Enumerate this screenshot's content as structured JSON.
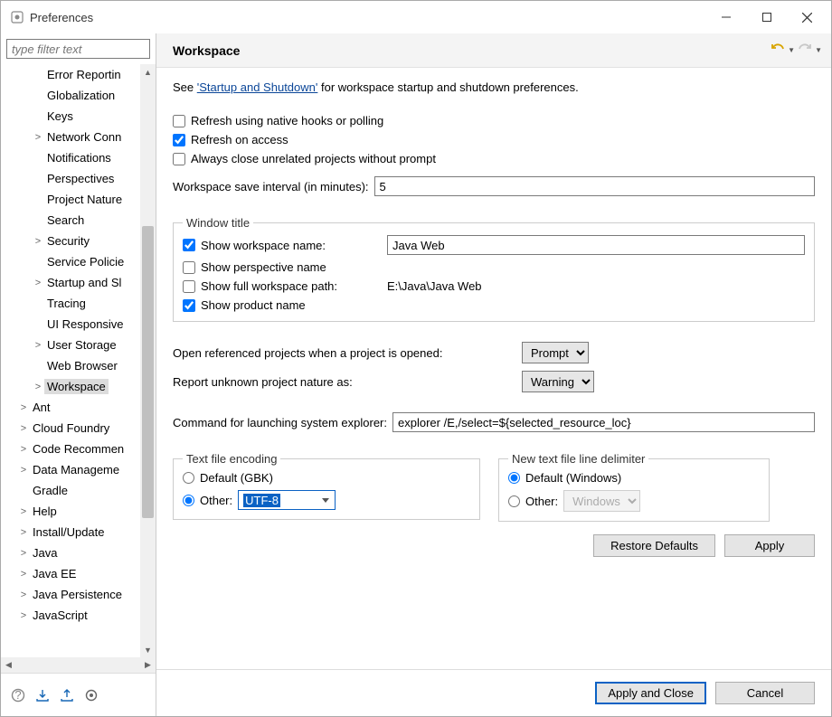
{
  "window": {
    "title": "Preferences"
  },
  "sidebar": {
    "filter_placeholder": "type filter text",
    "items": [
      {
        "label": "Error Reportin",
        "indent": 1,
        "expand": ""
      },
      {
        "label": "Globalization",
        "indent": 1,
        "expand": ""
      },
      {
        "label": "Keys",
        "indent": 1,
        "expand": ""
      },
      {
        "label": "Network Conn",
        "indent": 1,
        "expand": ">"
      },
      {
        "label": "Notifications",
        "indent": 1,
        "expand": ""
      },
      {
        "label": "Perspectives",
        "indent": 1,
        "expand": ""
      },
      {
        "label": "Project Nature",
        "indent": 1,
        "expand": ""
      },
      {
        "label": "Search",
        "indent": 1,
        "expand": ""
      },
      {
        "label": "Security",
        "indent": 1,
        "expand": ">"
      },
      {
        "label": "Service Policie",
        "indent": 1,
        "expand": ""
      },
      {
        "label": "Startup and Sl",
        "indent": 1,
        "expand": ">"
      },
      {
        "label": "Tracing",
        "indent": 1,
        "expand": ""
      },
      {
        "label": "UI Responsive",
        "indent": 1,
        "expand": ""
      },
      {
        "label": "User Storage",
        "indent": 1,
        "expand": ">"
      },
      {
        "label": "Web Browser",
        "indent": 1,
        "expand": ""
      },
      {
        "label": "Workspace",
        "indent": 1,
        "expand": ">",
        "selected": true
      },
      {
        "label": "Ant",
        "indent": 0,
        "expand": ">"
      },
      {
        "label": "Cloud Foundry",
        "indent": 0,
        "expand": ">"
      },
      {
        "label": "Code Recommen",
        "indent": 0,
        "expand": ">"
      },
      {
        "label": "Data Manageme",
        "indent": 0,
        "expand": ">"
      },
      {
        "label": "Gradle",
        "indent": 0,
        "expand": ""
      },
      {
        "label": "Help",
        "indent": 0,
        "expand": ">"
      },
      {
        "label": "Install/Update",
        "indent": 0,
        "expand": ">"
      },
      {
        "label": "Java",
        "indent": 0,
        "expand": ">"
      },
      {
        "label": "Java EE",
        "indent": 0,
        "expand": ">"
      },
      {
        "label": "Java Persistence",
        "indent": 0,
        "expand": ">"
      },
      {
        "label": "JavaScript",
        "indent": 0,
        "expand": ">"
      }
    ]
  },
  "page": {
    "title": "Workspace",
    "intro_pre": "See ",
    "intro_link": "'Startup and Shutdown'",
    "intro_post": " for workspace startup and shutdown preferences.",
    "chk_refresh_native": "Refresh using native hooks or polling",
    "chk_refresh_access": "Refresh on access",
    "chk_close_unrelated": "Always close unrelated projects without prompt",
    "save_interval_label": "Workspace save interval (in minutes):",
    "save_interval_value": "5",
    "window_title_legend": "Window title",
    "chk_show_workspace_name": "Show workspace name:",
    "workspace_name_value": "Java Web",
    "chk_show_perspective": "Show perspective name",
    "chk_show_full_path": "Show full workspace path:",
    "full_path_value": "E:\\Java\\Java Web",
    "chk_show_product": "Show product name",
    "open_ref_label": "Open referenced projects when a project is opened:",
    "open_ref_value": "Prompt",
    "report_unknown_label": "Report unknown project nature as:",
    "report_unknown_value": "Warning",
    "explorer_cmd_label": "Command for launching system explorer:",
    "explorer_cmd_value": "explorer /E,/select=${selected_resource_loc}",
    "encoding_legend": "Text file encoding",
    "encoding_default_label": "Default (GBK)",
    "encoding_other_label": "Other:",
    "encoding_other_value": "UTF-8",
    "linedelim_legend": "New text file line delimiter",
    "linedelim_default_label": "Default (Windows)",
    "linedelim_other_label": "Other:",
    "linedelim_other_value": "Windows",
    "btn_restore": "Restore Defaults",
    "btn_apply": "Apply",
    "btn_apply_close": "Apply and Close",
    "btn_cancel": "Cancel"
  }
}
